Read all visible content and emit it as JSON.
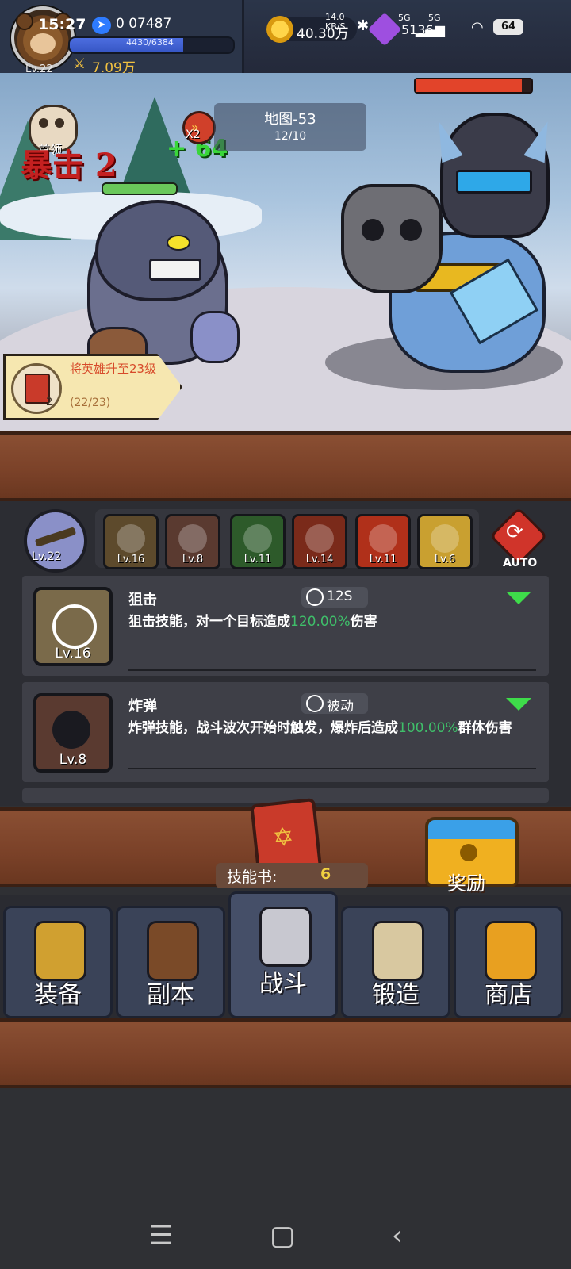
{
  "status_bar": {
    "time": "15:27",
    "battery": "64",
    "network_left": "14.0",
    "network_right": "KB/S",
    "signal1": "5G",
    "signal2": "5G"
  },
  "player": {
    "level_label": "Lv.22",
    "id_text": "0 07487",
    "xp_text": "4430/6384",
    "xp_fraction": 0.694,
    "power": "7.09万"
  },
  "currency": {
    "gold": "40.30万",
    "gems": "5136"
  },
  "battle": {
    "boss_label": "首领",
    "crit_text": "暴击 2",
    "heal_text": "+ 64",
    "speed_label": "X2",
    "map_title": "地图-53",
    "map_progress": "12/10",
    "enemy_hp_fraction": 0.92
  },
  "quest": {
    "title": "将英雄升至23级",
    "progress": "(22/23)",
    "book_count": "2"
  },
  "skills_bar": {
    "hero_level": "Lv.22",
    "auto_label": "AUTO",
    "slots": [
      {
        "level": "Lv.16",
        "icon": "sniper-skill-icon",
        "color": "#5d4a2c"
      },
      {
        "level": "Lv.8",
        "icon": "bomb-skill-icon",
        "color": "#5a3a30"
      },
      {
        "level": "Lv.11",
        "icon": "poison-skill-icon",
        "color": "#2d5a2a"
      },
      {
        "level": "Lv.14",
        "icon": "fire-skill-icon",
        "color": "#7a2a1a"
      },
      {
        "level": "Lv.11",
        "icon": "sun-skill-icon",
        "color": "#b0301a"
      },
      {
        "level": "Lv.6",
        "icon": "lightning-skill-icon",
        "color": "#c9a030"
      }
    ]
  },
  "skill_cards": [
    {
      "name": "狙击",
      "cooldown": "12S",
      "level": "Lv.16",
      "desc_before": "狙击技能，对一个目标造成",
      "desc_highlight": "120.00%",
      "desc_after": "伤害"
    },
    {
      "name": "炸弹",
      "cooldown": "被动",
      "level": "Lv.8",
      "desc_before": "炸弹技能，战斗波次开始时触发，爆炸后造成",
      "desc_highlight": "100.00%",
      "desc_after": "群体伤害"
    }
  ],
  "skill_book": {
    "label": "技能书:",
    "count": "6"
  },
  "reward_label": "奖励",
  "nav": [
    {
      "label": "装备",
      "icon": "helmet-icon"
    },
    {
      "label": "副本",
      "icon": "sword-shield-icon"
    },
    {
      "label": "战斗",
      "icon": "crossed-swords-icon"
    },
    {
      "label": "锻造",
      "icon": "hammer-scroll-icon"
    },
    {
      "label": "商店",
      "icon": "shop-icon"
    }
  ],
  "colors": {
    "wood": "#7a4128",
    "panel": "#2c2d33",
    "highlight_green": "#3fbf6a",
    "gold": "#f0c040"
  }
}
